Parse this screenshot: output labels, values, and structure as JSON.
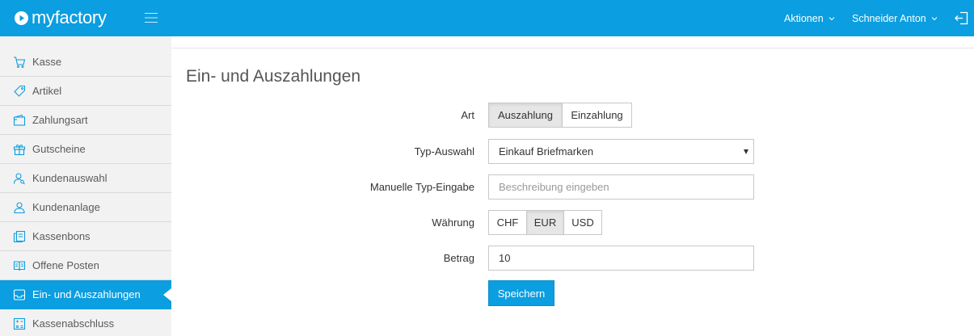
{
  "header": {
    "logo_text": "myfactory",
    "actions_label": "Aktionen",
    "user_label": "Schneider Anton"
  },
  "sidebar": {
    "items": [
      {
        "label": "Kasse",
        "icon": "cart-icon"
      },
      {
        "label": "Artikel",
        "icon": "tag-icon"
      },
      {
        "label": "Zahlungsart",
        "icon": "wallet-icon"
      },
      {
        "label": "Gutscheine",
        "icon": "gift-icon"
      },
      {
        "label": "Kundenauswahl",
        "icon": "user-search-icon"
      },
      {
        "label": "Kundenanlage",
        "icon": "user-icon"
      },
      {
        "label": "Kassenbons",
        "icon": "receipt-icon"
      },
      {
        "label": "Offene Posten",
        "icon": "book-icon"
      },
      {
        "label": "Ein- und Auszahlungen",
        "icon": "inbox-icon",
        "active": true
      },
      {
        "label": "Kassenabschluss",
        "icon": "calculator-icon"
      }
    ]
  },
  "main": {
    "title": "Ein- und Auszahlungen",
    "form": {
      "art": {
        "label": "Art",
        "options": [
          "Auszahlung",
          "Einzahlung"
        ],
        "selected": "Auszahlung"
      },
      "typ_auswahl": {
        "label": "Typ-Auswahl",
        "value": "Einkauf Briefmarken"
      },
      "manuelle_typ": {
        "label": "Manuelle Typ-Eingabe",
        "placeholder": "Beschreibung eingeben",
        "value": ""
      },
      "waehrung": {
        "label": "Währung",
        "options": [
          "CHF",
          "EUR",
          "USD"
        ],
        "selected": "EUR"
      },
      "betrag": {
        "label": "Betrag",
        "value": "10"
      },
      "save_label": "Speichern"
    }
  },
  "colors": {
    "brand_blue": "#0b9ee0",
    "sidebar_bg": "#f2f2f2",
    "selected_segment_bg": "#e6e6e6"
  }
}
